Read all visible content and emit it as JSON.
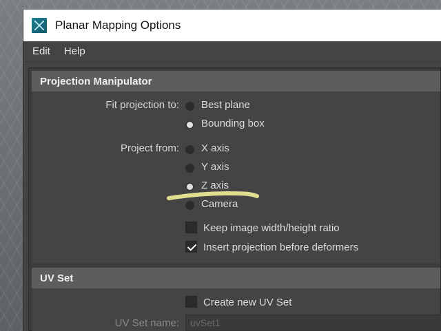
{
  "window": {
    "title": "Planar Mapping Options"
  },
  "menu": {
    "edit": "Edit",
    "help": "Help"
  },
  "projection_manipulator": {
    "header": "Projection Manipulator",
    "fit_label": "Fit projection to:",
    "fit_options": [
      "Best plane",
      "Bounding box"
    ],
    "fit_selected": "Bounding box",
    "project_label": "Project from:",
    "project_options": [
      "X axis",
      "Y axis",
      "Z axis",
      "Camera"
    ],
    "project_selected": "Z axis",
    "keep_ratio_label": "Keep image width/height ratio",
    "keep_ratio_checked": false,
    "insert_projection_label": "Insert projection before deformers",
    "insert_projection_checked": true
  },
  "uv_set": {
    "header": "UV Set",
    "create_new_label": "Create new UV Set",
    "create_new_checked": false,
    "name_label": "UV Set name:",
    "name_value": "uvSet1"
  },
  "colors": {
    "highlight_stroke": "#f3ef9a"
  }
}
